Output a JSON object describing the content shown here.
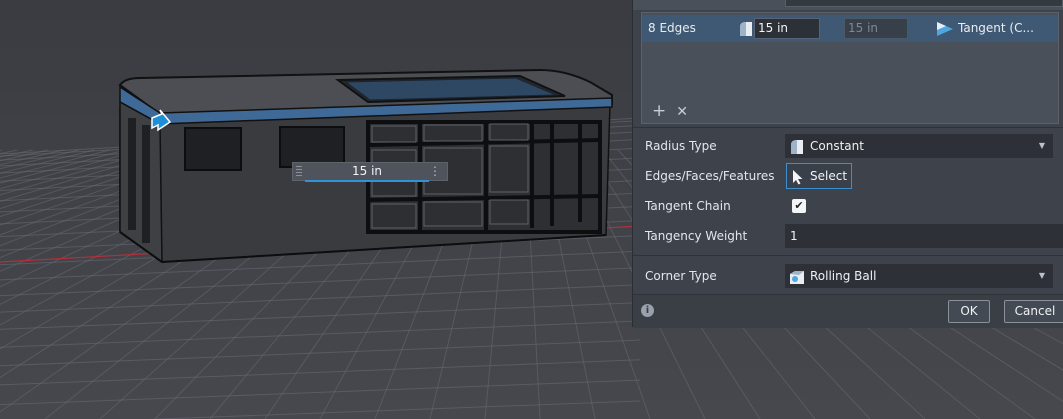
{
  "viewport": {
    "dimension_value": "15 in",
    "icons": {
      "manipulator": "arrow-manipulator-icon",
      "grip": "grip-icon",
      "menu": "kebab-menu-icon"
    }
  },
  "panel": {
    "edge_list": {
      "row": {
        "count_label": "8 Edges",
        "radius_value": "15 in",
        "radius_end_value": "15 in",
        "tangency_label": "Tangent (C..."
      },
      "add_icon": "+",
      "remove_icon": "✕"
    },
    "radius_type": {
      "label": "Radius Type",
      "value": "Constant"
    },
    "edges_faces_features": {
      "label": "Edges/Faces/Features",
      "button_label": "Select"
    },
    "tangent_chain": {
      "label": "Tangent Chain",
      "checked": "✔"
    },
    "tangency_weight": {
      "label": "Tangency Weight",
      "value": "1"
    },
    "corner_type": {
      "label": "Corner Type",
      "value": "Rolling Ball"
    },
    "footer": {
      "info_icon": "i",
      "ok_label": "OK",
      "cancel_label": "Cancel"
    }
  },
  "colors": {
    "selection_blue": "#2f93d8",
    "viewport_bg": "#3b3d42",
    "panel_bg": "#3e434b",
    "highlight_row": "#3f5873"
  }
}
